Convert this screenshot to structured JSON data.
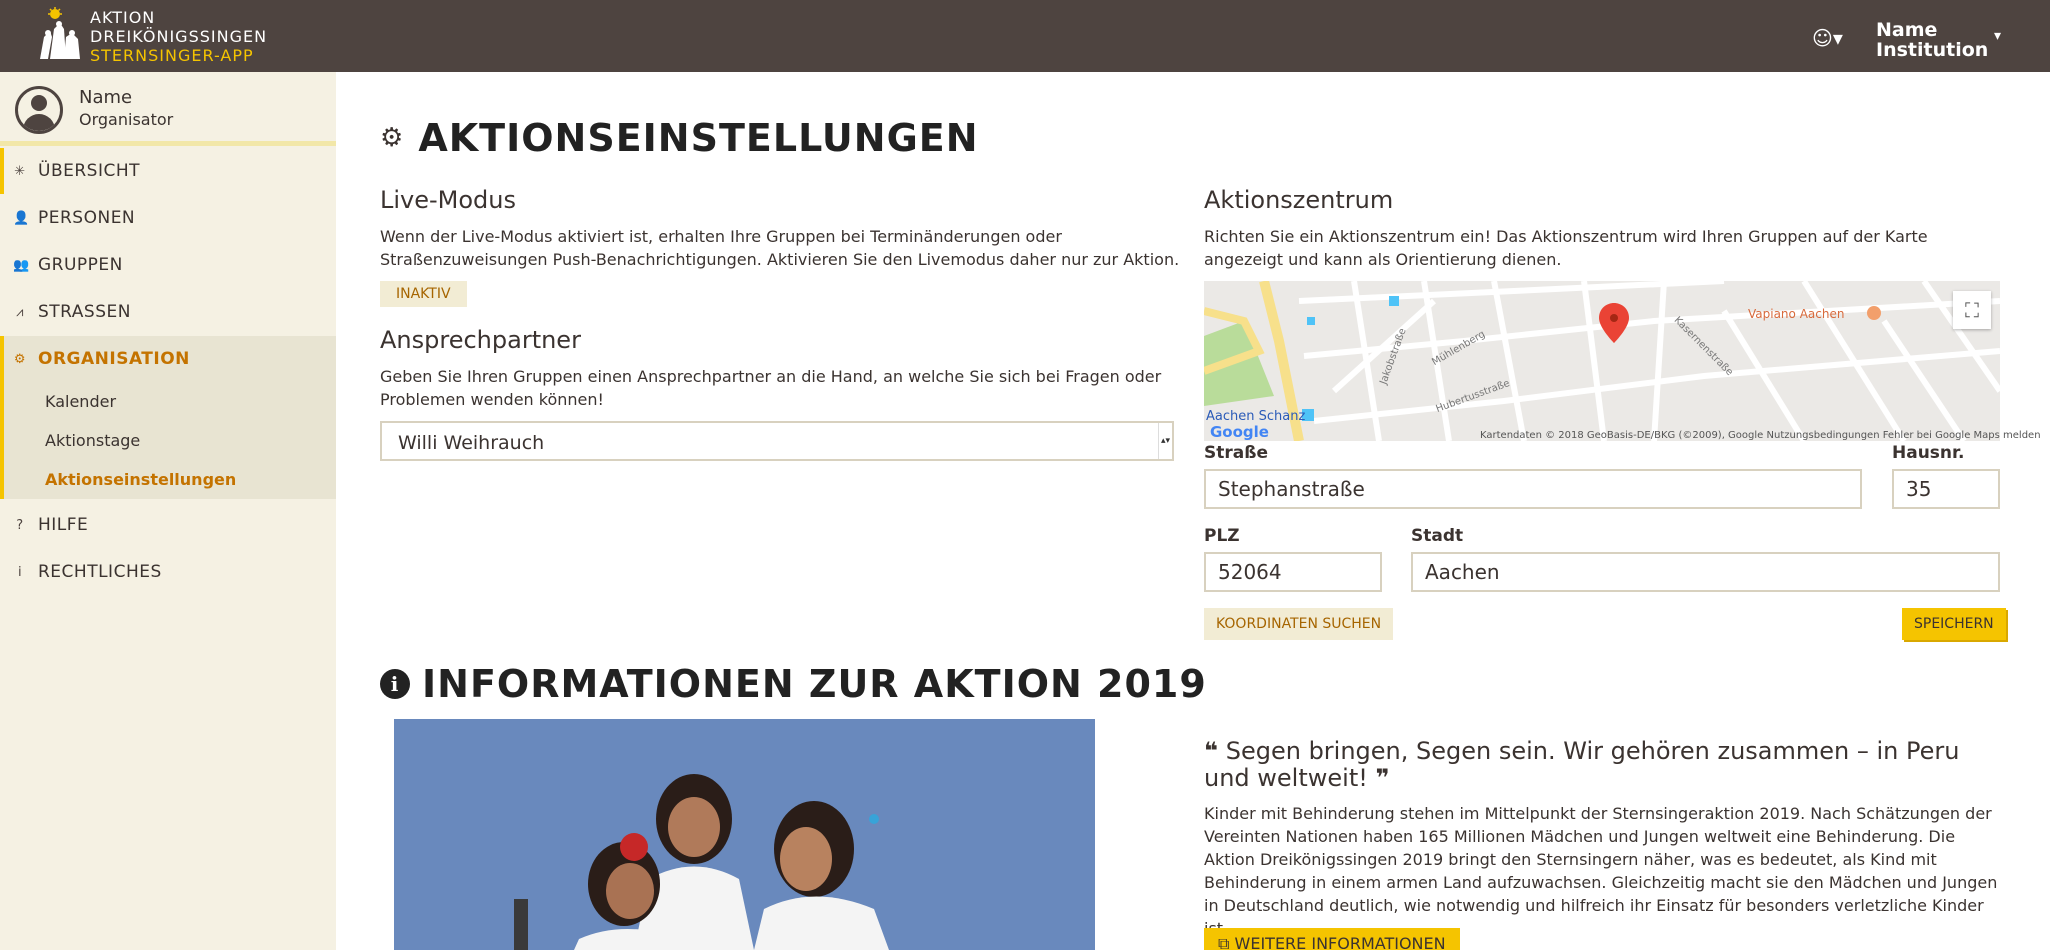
{
  "header": {
    "logo_line1": "AKTION",
    "logo_line2": "DREIKÖNIGSSINGEN",
    "logo_line3": "STERNSINGER-APP",
    "smiley_menu": "☺▾",
    "user_line1": "Name",
    "user_line2": "Institution",
    "caret": "▾"
  },
  "sidebar": {
    "profile_name": "Name",
    "profile_role": "Organisator",
    "items": [
      {
        "label": "ÜBERSICHT",
        "icon": "✳"
      },
      {
        "label": "PERSONEN",
        "icon": "👤"
      },
      {
        "label": "GRUPPEN",
        "icon": "👥"
      },
      {
        "label": "STRASSEN",
        "icon": "⩘"
      },
      {
        "label": "ORGANISATION",
        "icon": "⚙"
      },
      {
        "label": "HILFE",
        "icon": "?"
      },
      {
        "label": "RECHTLICHES",
        "icon": "i"
      }
    ],
    "subitems": [
      "Kalender",
      "Aktionstage",
      "Aktionseinstellungen"
    ]
  },
  "main": {
    "page_title": "AKTIONSEINSTELLUNGEN",
    "live": {
      "title": "Live-Modus",
      "text": "Wenn der Live-Modus aktiviert ist, erhalten Ihre Gruppen bei Terminänderungen oder Straßenzuweisungen Push-Benachrichtigungen. Aktivieren Sie den Livemodus daher nur zur Aktion.",
      "status_button": "INAKTIV"
    },
    "contact": {
      "title": "Ansprechpartner",
      "text": "Geben Sie Ihren Gruppen einen Ansprechpartner an die Hand, an welche Sie sich bei Fragen oder Problemen wenden können!",
      "selected": "Willi Weihrauch"
    },
    "center": {
      "title": "Aktionszentrum",
      "text": "Richten Sie ein Aktionszentrum ein! Das Aktionszentrum wird Ihren Gruppen auf der Karte angezeigt und kann als Orientierung dienen.",
      "map_attribution": "Kartendaten © 2018 GeoBasis-DE/BKG (©2009), Google    Nutzungsbedingungen    Fehler bei Google Maps melden",
      "map_poi": "Vapiano Aachen",
      "map_station": "Aachen Schanz",
      "map_google": "Google",
      "street_label": "Straße",
      "street_value": "Stephanstraße",
      "house_label": "Hausnr.",
      "house_value": "35",
      "zip_label": "PLZ",
      "zip_value": "52064",
      "city_label": "Stadt",
      "city_value": "Aachen",
      "coords_button": "KOORDINATEN SUCHEN",
      "save_button": "SPEICHERN"
    },
    "info": {
      "title": "INFORMATIONEN ZUR AKTION 2019",
      "quote": "Segen bringen, Segen sein. Wir gehören zusammen – in Peru und weltweit!",
      "text": "Kinder mit Behinderung stehen im Mittelpunkt der Sternsingeraktion 2019. Nach Schätzungen der Vereinten Nationen haben 165 Millionen Mädchen und Jungen weltweit eine Behinderung. Die Aktion Dreikönigssingen 2019 bringt den Sternsingern näher, was es bedeutet, als Kind mit Behinderung in einem armen Land aufzuwachsen. Gleichzeitig macht sie den Mädchen und Jungen in Deutschland deutlich, wie notwendig und hilfreich ihr Einsatz für besonders verletzliche Kinder ist.",
      "more_button": "WEITERE INFORMATIONEN"
    }
  }
}
